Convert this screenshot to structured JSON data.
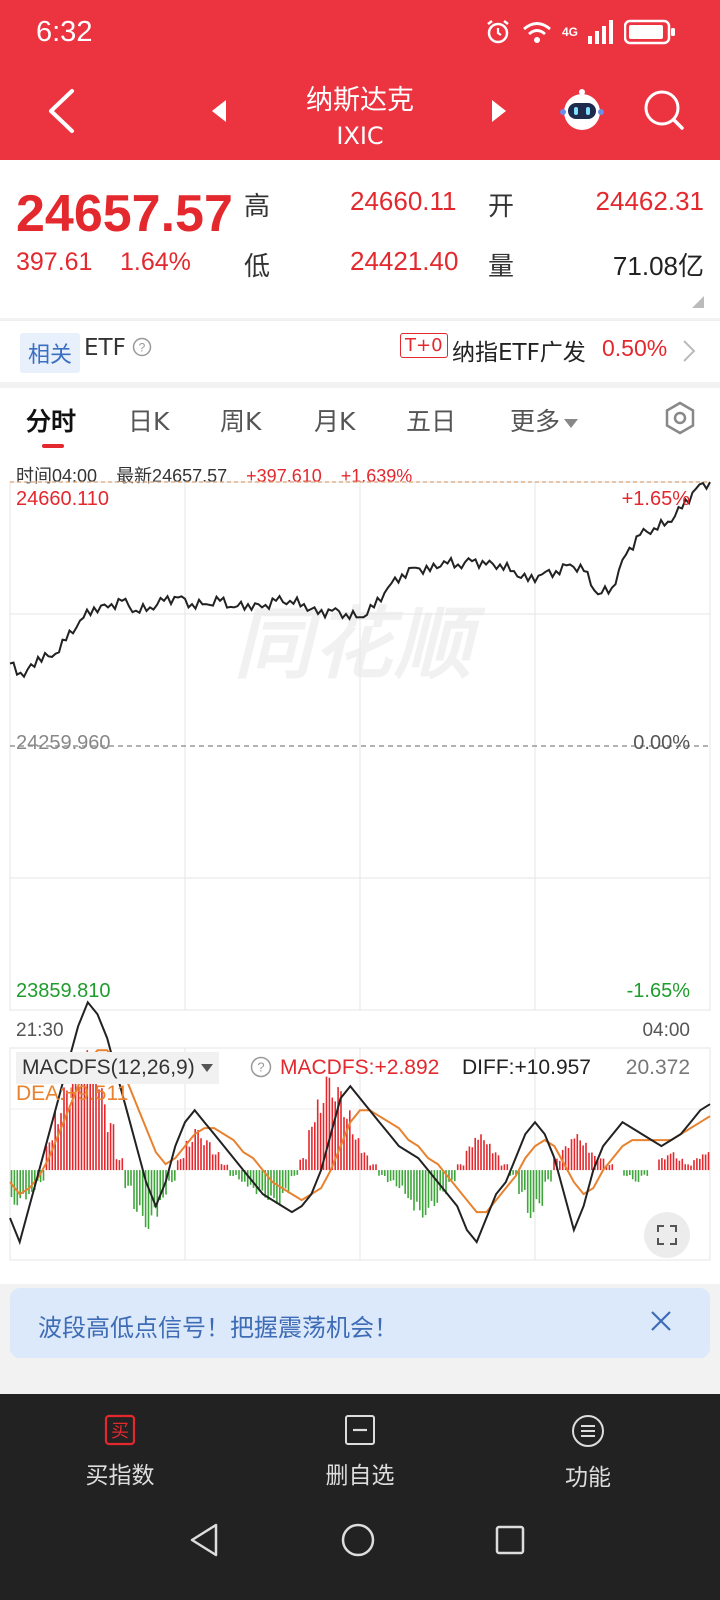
{
  "status_bar": {
    "time": "6:32",
    "network": "4G"
  },
  "header": {
    "title": "纳斯达克",
    "subtitle": "IXIC"
  },
  "quote": {
    "price": "24657.57",
    "change": "397.61",
    "change_pct": "1.64%",
    "high_label": "高",
    "high": "24660.11",
    "low_label": "低",
    "low": "24421.40",
    "open_label": "开",
    "open": "24462.31",
    "volume_label": "量",
    "volume": "71.08亿"
  },
  "etf": {
    "tag": "相关",
    "label": "ETF",
    "t0_badge": "T+0",
    "name": "纳指ETF广发",
    "pct": "0.50%"
  },
  "tabs": [
    "分时",
    "日K",
    "周K",
    "月K",
    "五日",
    "更多"
  ],
  "chart_info": {
    "time": "时间04:00",
    "latest": "最新24657.57",
    "change": "+397.610",
    "pct": "+1.639%"
  },
  "watermark": "同花顺",
  "chart_data": [
    {
      "type": "line",
      "x_start": "21:30",
      "x_end": "04:00",
      "y_max_label": "24660.110",
      "y_base_label": "24259.960",
      "y_min_label": "23859.810",
      "pct_max_label": "+1.65%",
      "pct_base_label": "0.00%",
      "pct_min_label": "-1.65%",
      "ylim": [
        23859.81,
        24660.11
      ],
      "base": 24259.96,
      "colors": {
        "up": "#e3282e",
        "down": "#1f9c2e",
        "line": "#222222"
      },
      "x": [
        0,
        2,
        4,
        6,
        8,
        10,
        12,
        14,
        16,
        18,
        20,
        22,
        24,
        26,
        28,
        30,
        32,
        34,
        36,
        38,
        40,
        42,
        44,
        46,
        48,
        50,
        52,
        54,
        56,
        58,
        60,
        62,
        64,
        66,
        68,
        70,
        72,
        74,
        76,
        78,
        80,
        82,
        84,
        86,
        88,
        90,
        92,
        94,
        96,
        98,
        100
      ],
      "values": [
        24385,
        24365,
        24395,
        24395,
        24420,
        24450,
        24470,
        24470,
        24480,
        24465,
        24470,
        24480,
        24485,
        24475,
        24475,
        24480,
        24470,
        24475,
        24470,
        24480,
        24480,
        24475,
        24460,
        24465,
        24460,
        24455,
        24470,
        24500,
        24520,
        24530,
        24525,
        24540,
        24535,
        24540,
        24535,
        24535,
        24525,
        24510,
        24520,
        24525,
        24535,
        24525,
        24490,
        24500,
        24550,
        24580,
        24590,
        24600,
        24620,
        24650,
        24660
      ]
    },
    {
      "type": "bar",
      "title": "MACDFS(12,26,9)",
      "y_top_label": "20.372",
      "series": [
        {
          "name": "MACDFS",
          "display": "MACDFS:+2.892"
        },
        {
          "name": "DIFF",
          "display": "DIFF:+10.957"
        },
        {
          "name": "DEA",
          "display": "DEA:+9.511"
        }
      ],
      "ylim": [
        -15,
        20.372
      ],
      "macd_values": [
        -6,
        -5,
        -4,
        -2,
        5,
        10,
        14,
        18,
        20,
        18,
        14,
        8,
        2,
        -3,
        -7,
        -10,
        -8,
        -5,
        -2,
        2,
        5,
        7,
        5,
        3,
        1,
        -1,
        -2,
        -3,
        -4,
        -5,
        -6,
        -4,
        -1,
        2,
        8,
        12,
        16,
        14,
        10,
        6,
        3,
        1,
        -1,
        -2,
        -3,
        -5,
        -7,
        -8,
        -6,
        -4,
        -2,
        1,
        4,
        6,
        5,
        3,
        1,
        -1,
        -4,
        -8,
        -6,
        -2,
        2,
        4,
        6,
        5,
        3,
        2,
        1,
        0,
        -1,
        -2,
        -1,
        0,
        2,
        3,
        2,
        1,
        2,
        3
      ],
      "diff_values": [
        -8,
        -12,
        -6,
        0,
        6,
        12,
        18,
        24,
        28,
        26,
        22,
        16,
        10,
        4,
        -2,
        -6,
        -2,
        4,
        8,
        10,
        8,
        6,
        4,
        2,
        0,
        -2,
        -4,
        -5,
        -6,
        -7,
        -6,
        -4,
        0,
        6,
        12,
        14,
        12,
        10,
        8,
        6,
        4,
        3,
        2,
        0,
        -2,
        -4,
        -6,
        -10,
        -12,
        -8,
        -4,
        -2,
        2,
        6,
        8,
        6,
        2,
        -4,
        -10,
        -6,
        0,
        4,
        6,
        8,
        7,
        6,
        5,
        4,
        5,
        6,
        8,
        10,
        11
      ],
      "dea_values": [
        -2,
        -4,
        -3,
        -1,
        2,
        6,
        10,
        14,
        18,
        20,
        20,
        18,
        15,
        11,
        7,
        3,
        1,
        2,
        4,
        6,
        7,
        7,
        6,
        5,
        3,
        2,
        0,
        -2,
        -3,
        -4,
        -5,
        -4,
        -3,
        0,
        4,
        8,
        10,
        10,
        9,
        8,
        7,
        5,
        4,
        2,
        1,
        -1,
        -3,
        -5,
        -7,
        -7,
        -5,
        -3,
        -1,
        2,
        4,
        5,
        4,
        1,
        -2,
        -4,
        -3,
        0,
        2,
        4,
        5,
        5,
        5,
        5,
        5,
        6,
        7,
        8,
        9
      ]
    }
  ],
  "banner": {
    "text": "波段高低点信号！把握震荡机会！"
  },
  "bottom_nav": [
    {
      "label": "买指数",
      "icon_text": "买"
    },
    {
      "label": "删自选"
    },
    {
      "label": "功能"
    }
  ]
}
